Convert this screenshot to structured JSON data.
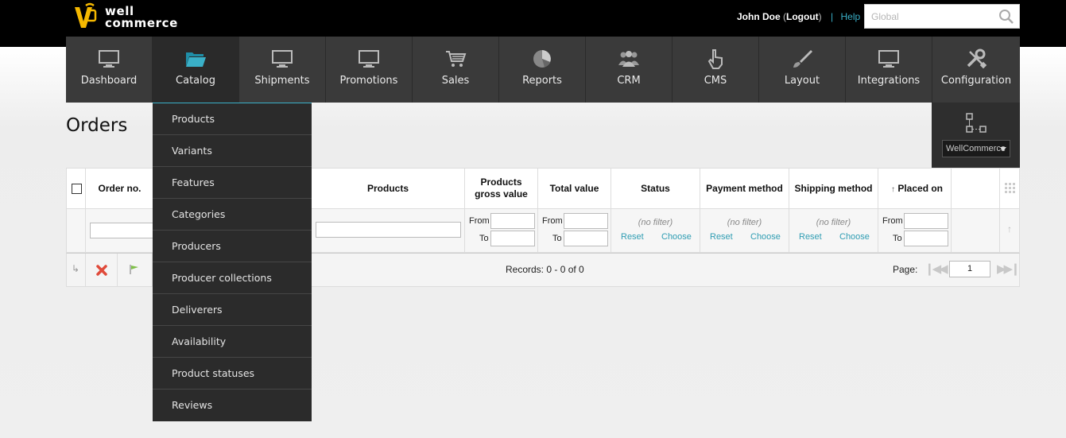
{
  "brand": {
    "line1": "well",
    "line2": "commerce"
  },
  "user": {
    "name": "John Doe",
    "logout": "Logout",
    "help": "Help"
  },
  "search": {
    "placeholder": "Global"
  },
  "nav": [
    {
      "label": "Dashboard",
      "icon": "monitor-icon"
    },
    {
      "label": "Catalog",
      "icon": "folder-open-icon"
    },
    {
      "label": "Shipments",
      "icon": "monitor-icon"
    },
    {
      "label": "Promotions",
      "icon": "monitor-icon"
    },
    {
      "label": "Sales",
      "icon": "cart-icon"
    },
    {
      "label": "Reports",
      "icon": "pie-chart-icon"
    },
    {
      "label": "CRM",
      "icon": "users-icon"
    },
    {
      "label": "CMS",
      "icon": "hand-pointer-icon"
    },
    {
      "label": "Layout",
      "icon": "brush-icon"
    },
    {
      "label": "Integrations",
      "icon": "monitor-icon"
    },
    {
      "label": "Configuration",
      "icon": "tools-icon"
    }
  ],
  "page": {
    "title": "Orders"
  },
  "view_selector": {
    "value": "WellCommerce"
  },
  "catalog_menu": [
    "Products",
    "Variants",
    "Features",
    "Categories",
    "Producers",
    "Producer collections",
    "Deliverers",
    "Availability",
    "Product statuses",
    "Reviews"
  ],
  "grid": {
    "columns": {
      "order_no": "Order no.",
      "products": "Products",
      "gross_line1": "Products",
      "gross_line2": "gross value",
      "total": "Total value",
      "status": "Status",
      "payment": "Payment method",
      "shipping": "Shipping method",
      "placed_on": "Placed on"
    },
    "filter": {
      "from": "From",
      "to": "To",
      "no_filter": "(no filter)",
      "reset": "Reset",
      "choose": "Choose"
    },
    "records": "Records: 0 - 0 of 0",
    "page_label": "Page:",
    "page_value": "1"
  },
  "colors": {
    "accent": "#3ab0c8",
    "nav_bg": "#3a3a3a",
    "dropdown_bg": "#2b2b2b",
    "logo_yellow": "#f5b800"
  }
}
